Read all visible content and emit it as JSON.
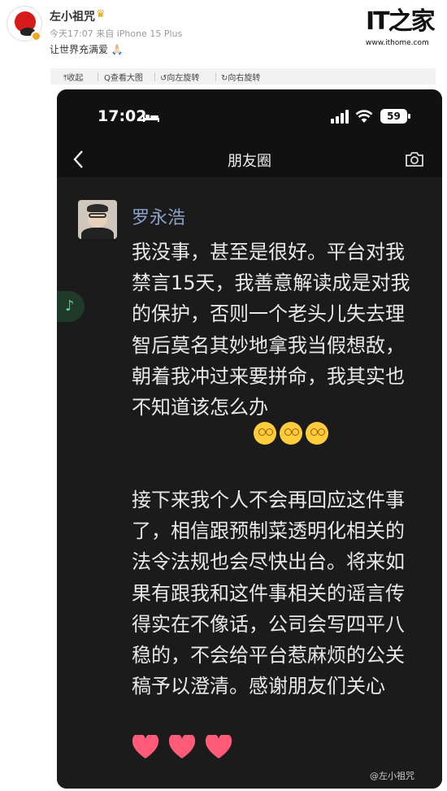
{
  "post": {
    "author": "左小祖咒",
    "meta": "今天17:07  来自 iPhone 15 Plus",
    "content": "让世界充满爱 🙏🏻"
  },
  "brand": {
    "logo": "IT之家",
    "url": "www.ithome.com"
  },
  "toolbar": {
    "items": [
      "⤒收起",
      "Q查看大图",
      "↺向左旋转",
      "↻向右旋转"
    ]
  },
  "phone": {
    "time": "17:02",
    "battery": "59",
    "nav_title": "朋友圈",
    "feed": {
      "name": "罗永浩",
      "paragraph1": "我没事，甚至是很好。平台对我禁言15天，我善意解读成是对我的保护，否则一个老头儿失去理智后莫名其妙地拿我当假想敌，朝着我冲过来要拼命，我其实也不知道该怎么办",
      "paragraph2": "接下来我个人不会再回应这件事了，相信跟预制菜透明化相关的法令法规也会尽快出台。将来如果有跟我和这件事相关的谣言传得实在不像话，公司会写四平八稳的，不会给平台惹麻烦的公关稿予以澄清。感谢朋友们关心"
    }
  },
  "watermark": "@左小祖咒",
  "colors": {
    "feed_name": "#8ca0c8",
    "phone_bg": "#1b1b1b",
    "heart": "#ff5a78"
  }
}
